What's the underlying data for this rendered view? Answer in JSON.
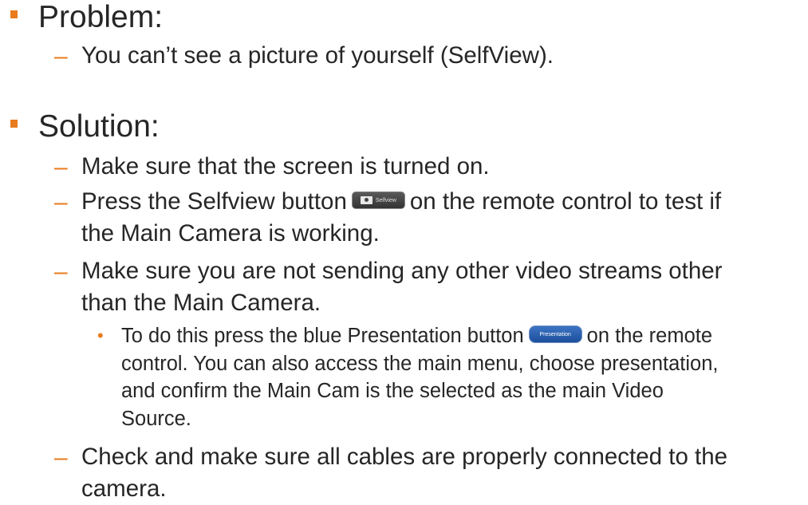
{
  "sections": [
    {
      "heading": "Problem:",
      "items": [
        {
          "text": "You can’t see a picture of yourself (SelfView)."
        }
      ]
    },
    {
      "heading": "Solution:",
      "items": [
        {
          "text": "Make sure that the screen is turned on."
        },
        {
          "text_before": "Press the Selfview button",
          "text_after": "on the remote control to test if",
          "text_line2": "the Main Camera is working."
        },
        {
          "line1": "Make sure you are not sending any other video streams other",
          "line2": "than the Main Camera.",
          "subitem": {
            "text_before": "To do this press the blue Presentation button",
            "text_after": "on the remote",
            "line2": "control. You can also access the main menu, choose presentation,",
            "line3": "and confirm the Main Cam is the selected as the main Video",
            "line4": "Source."
          }
        },
        {
          "line1": "Check and make sure all cables are properly connected to the",
          "line2": "camera."
        }
      ]
    }
  ],
  "buttons": {
    "selfview_label": "Selfview",
    "presentation_label": "Presentation"
  },
  "colors": {
    "bullet_accent": "#e87b1d",
    "text": "#262626",
    "selfview_button": "#444444",
    "presentation_button": "#2a5ead"
  },
  "icons": {
    "square_bullet": "square-bullet-icon",
    "dash_bullet": "dash-bullet-icon",
    "dot_bullet": "dot-bullet-icon",
    "selfview_camera": "camera-icon"
  }
}
